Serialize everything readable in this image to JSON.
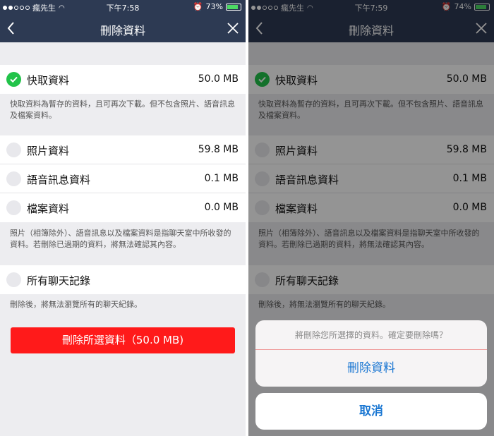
{
  "left": {
    "status": {
      "carrier": "瘋先生",
      "time": "下午7:58",
      "battery": "73%",
      "battery_level": 0.73
    },
    "title": "刪除資料",
    "cache": {
      "label": "快取資料",
      "size": "50.0 MB",
      "checked": true
    },
    "cache_note": "快取資料為暫存的資料，且可再次下載。但不包含照片、語音訊息及檔案資料。",
    "photos": {
      "label": "照片資料",
      "size": "59.8 MB"
    },
    "voice": {
      "label": "語音訊息資料",
      "size": "0.1 MB"
    },
    "files": {
      "label": "檔案資料",
      "size": "0.0 MB"
    },
    "media_note": "照片（相簿除外）、語音訊息以及檔案資料是指聊天室中所收發的資料。若刪除已過期的資料，將無法確認其內容。",
    "chats": {
      "label": "所有聊天記錄"
    },
    "chats_note": "刪除後，將無法瀏覽所有的聊天紀錄。",
    "delete_button": "刪除所選資料（50.0 MB)"
  },
  "right": {
    "status": {
      "carrier": "瘋先生",
      "time": "下午7:59",
      "battery": "74%",
      "battery_level": 0.74
    },
    "title": "刪除資料",
    "cache": {
      "label": "快取資料",
      "size": "50.0 MB",
      "checked": true
    },
    "cache_note": "快取資料為暫存的資料，且可再次下載。但不包含照片、語音訊息及檔案資料。",
    "photos": {
      "label": "照片資料",
      "size": "59.8 MB"
    },
    "voice": {
      "label": "語音訊息資料",
      "size": "0.1 MB"
    },
    "files": {
      "label": "檔案資料",
      "size": "0.0 MB"
    },
    "media_note": "照片（相簿除外）、語音訊息以及檔案資料是指聊天室中所收發的資料。若刪除已過期的資料，將無法確認其內容。",
    "chats": {
      "label": "所有聊天記錄"
    },
    "chats_note": "刪除後，將無法瀏覽所有的聊天紀錄。",
    "sheet": {
      "message": "將刪除您所選擇的資料。確定要刪除嗎？",
      "confirm": "刪除資料",
      "cancel": "取消"
    }
  },
  "icons": {
    "back": "chevron-left-icon",
    "close": "close-icon",
    "check": "checkmark-icon",
    "wifi": "wifi-icon",
    "alarm": "alarm-icon"
  },
  "colors": {
    "navbar": "#2d3a53",
    "check": "#22c34a",
    "delete": "#ff1a1a",
    "action": "#1976d2"
  }
}
